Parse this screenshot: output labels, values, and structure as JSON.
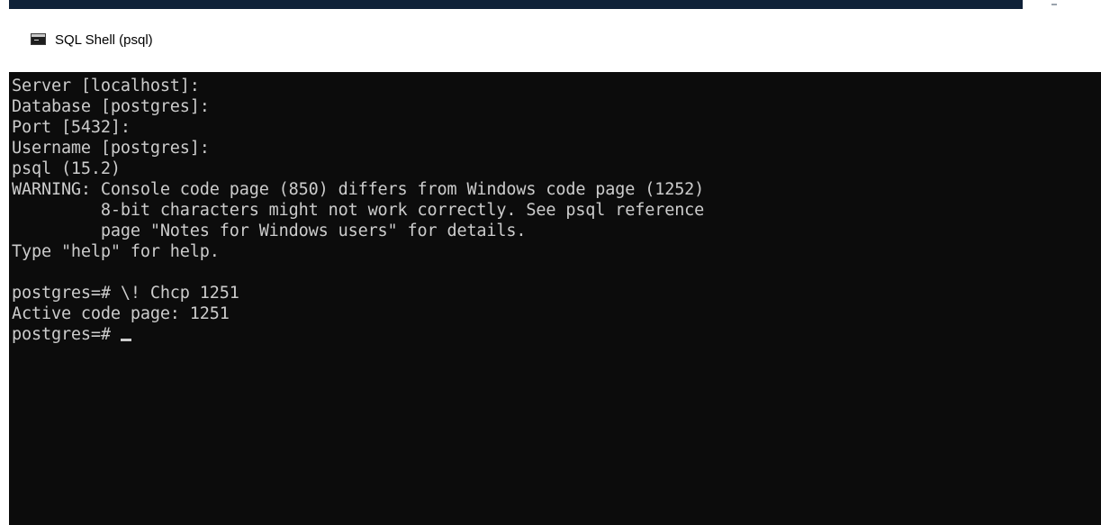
{
  "window": {
    "title": "SQL Shell (psql)",
    "icon": "console-window-icon"
  },
  "console": {
    "lines": [
      "Server [localhost]:",
      "Database [postgres]:",
      "Port [5432]:",
      "Username [postgres]:",
      "psql (15.2)",
      "WARNING: Console code page (850) differs from Windows code page (1252)",
      "         8-bit characters might not work correctly. See psql reference",
      "         page \"Notes for Windows users\" for details.",
      "Type \"help\" for help.",
      "",
      "postgres=# \\! Chcp 1251",
      "Active code page: 1251"
    ],
    "prompt": "postgres=# "
  },
  "colors": {
    "console_background": "#0c0c0c",
    "console_text": "#cccccc",
    "titlebar_background": "#ffffff",
    "top_accent": "#0f2138"
  }
}
